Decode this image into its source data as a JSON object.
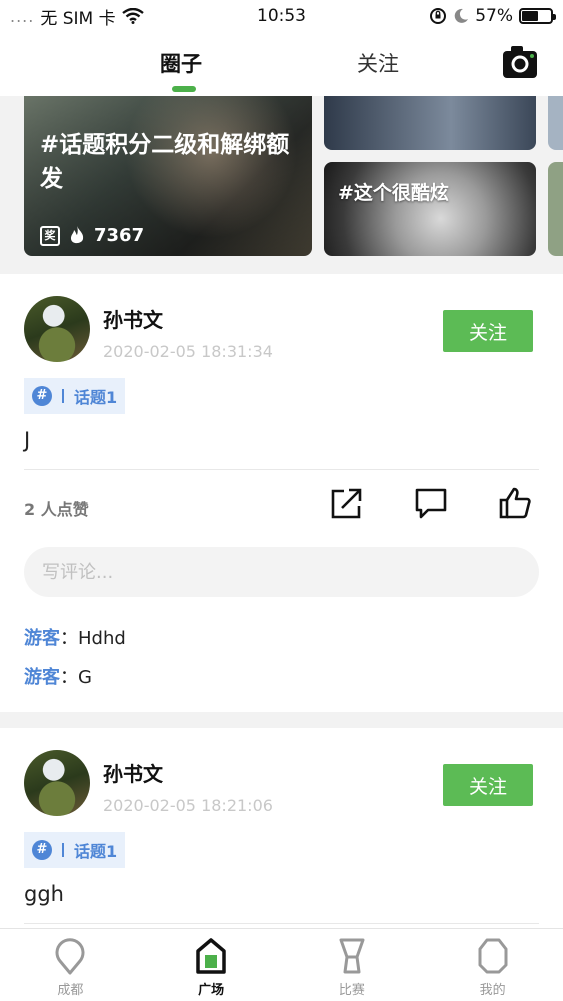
{
  "status_bar": {
    "signal": "....",
    "carrier": "无 SIM 卡",
    "time": "10:53",
    "battery_percent": "57%",
    "battery_level": 0.57
  },
  "top_nav": {
    "tabs": [
      {
        "label": "圈子",
        "active": true
      },
      {
        "label": "关注",
        "active": false
      }
    ],
    "camera_icon": "camera-icon"
  },
  "topics": {
    "big_card": {
      "title": "#话题积分二级和解绑额发",
      "award_label": "奖",
      "heat": "7367"
    },
    "small_card": {
      "title": "#这个很酷炫"
    }
  },
  "posts": [
    {
      "author": "孙书文",
      "time": "2020-02-05 18:31:34",
      "follow_label": "关注",
      "topic_tag": "话题1",
      "text": "J",
      "likes": "2 人点赞",
      "comment_placeholder": "写评论...",
      "comments": [
        {
          "who": "游客",
          "sep": "：",
          "text": "Hdhd"
        },
        {
          "who": "游客",
          "sep": "：",
          "text": "G"
        }
      ]
    },
    {
      "author": "孙书文",
      "time": "2020-02-05 18:21:06",
      "follow_label": "关注",
      "topic_tag": "话题1",
      "text": "ggh"
    }
  ],
  "tabbar": {
    "items": [
      {
        "label": "成都",
        "icon": "location-pin-icon",
        "active": false
      },
      {
        "label": "广场",
        "icon": "home-icon",
        "active": true
      },
      {
        "label": "比赛",
        "icon": "trophy-icon",
        "active": false
      },
      {
        "label": "我的",
        "icon": "profile-icon",
        "active": false
      }
    ]
  },
  "colors": {
    "accent_green": "#5cbb55",
    "link_blue": "#4f86d6"
  }
}
